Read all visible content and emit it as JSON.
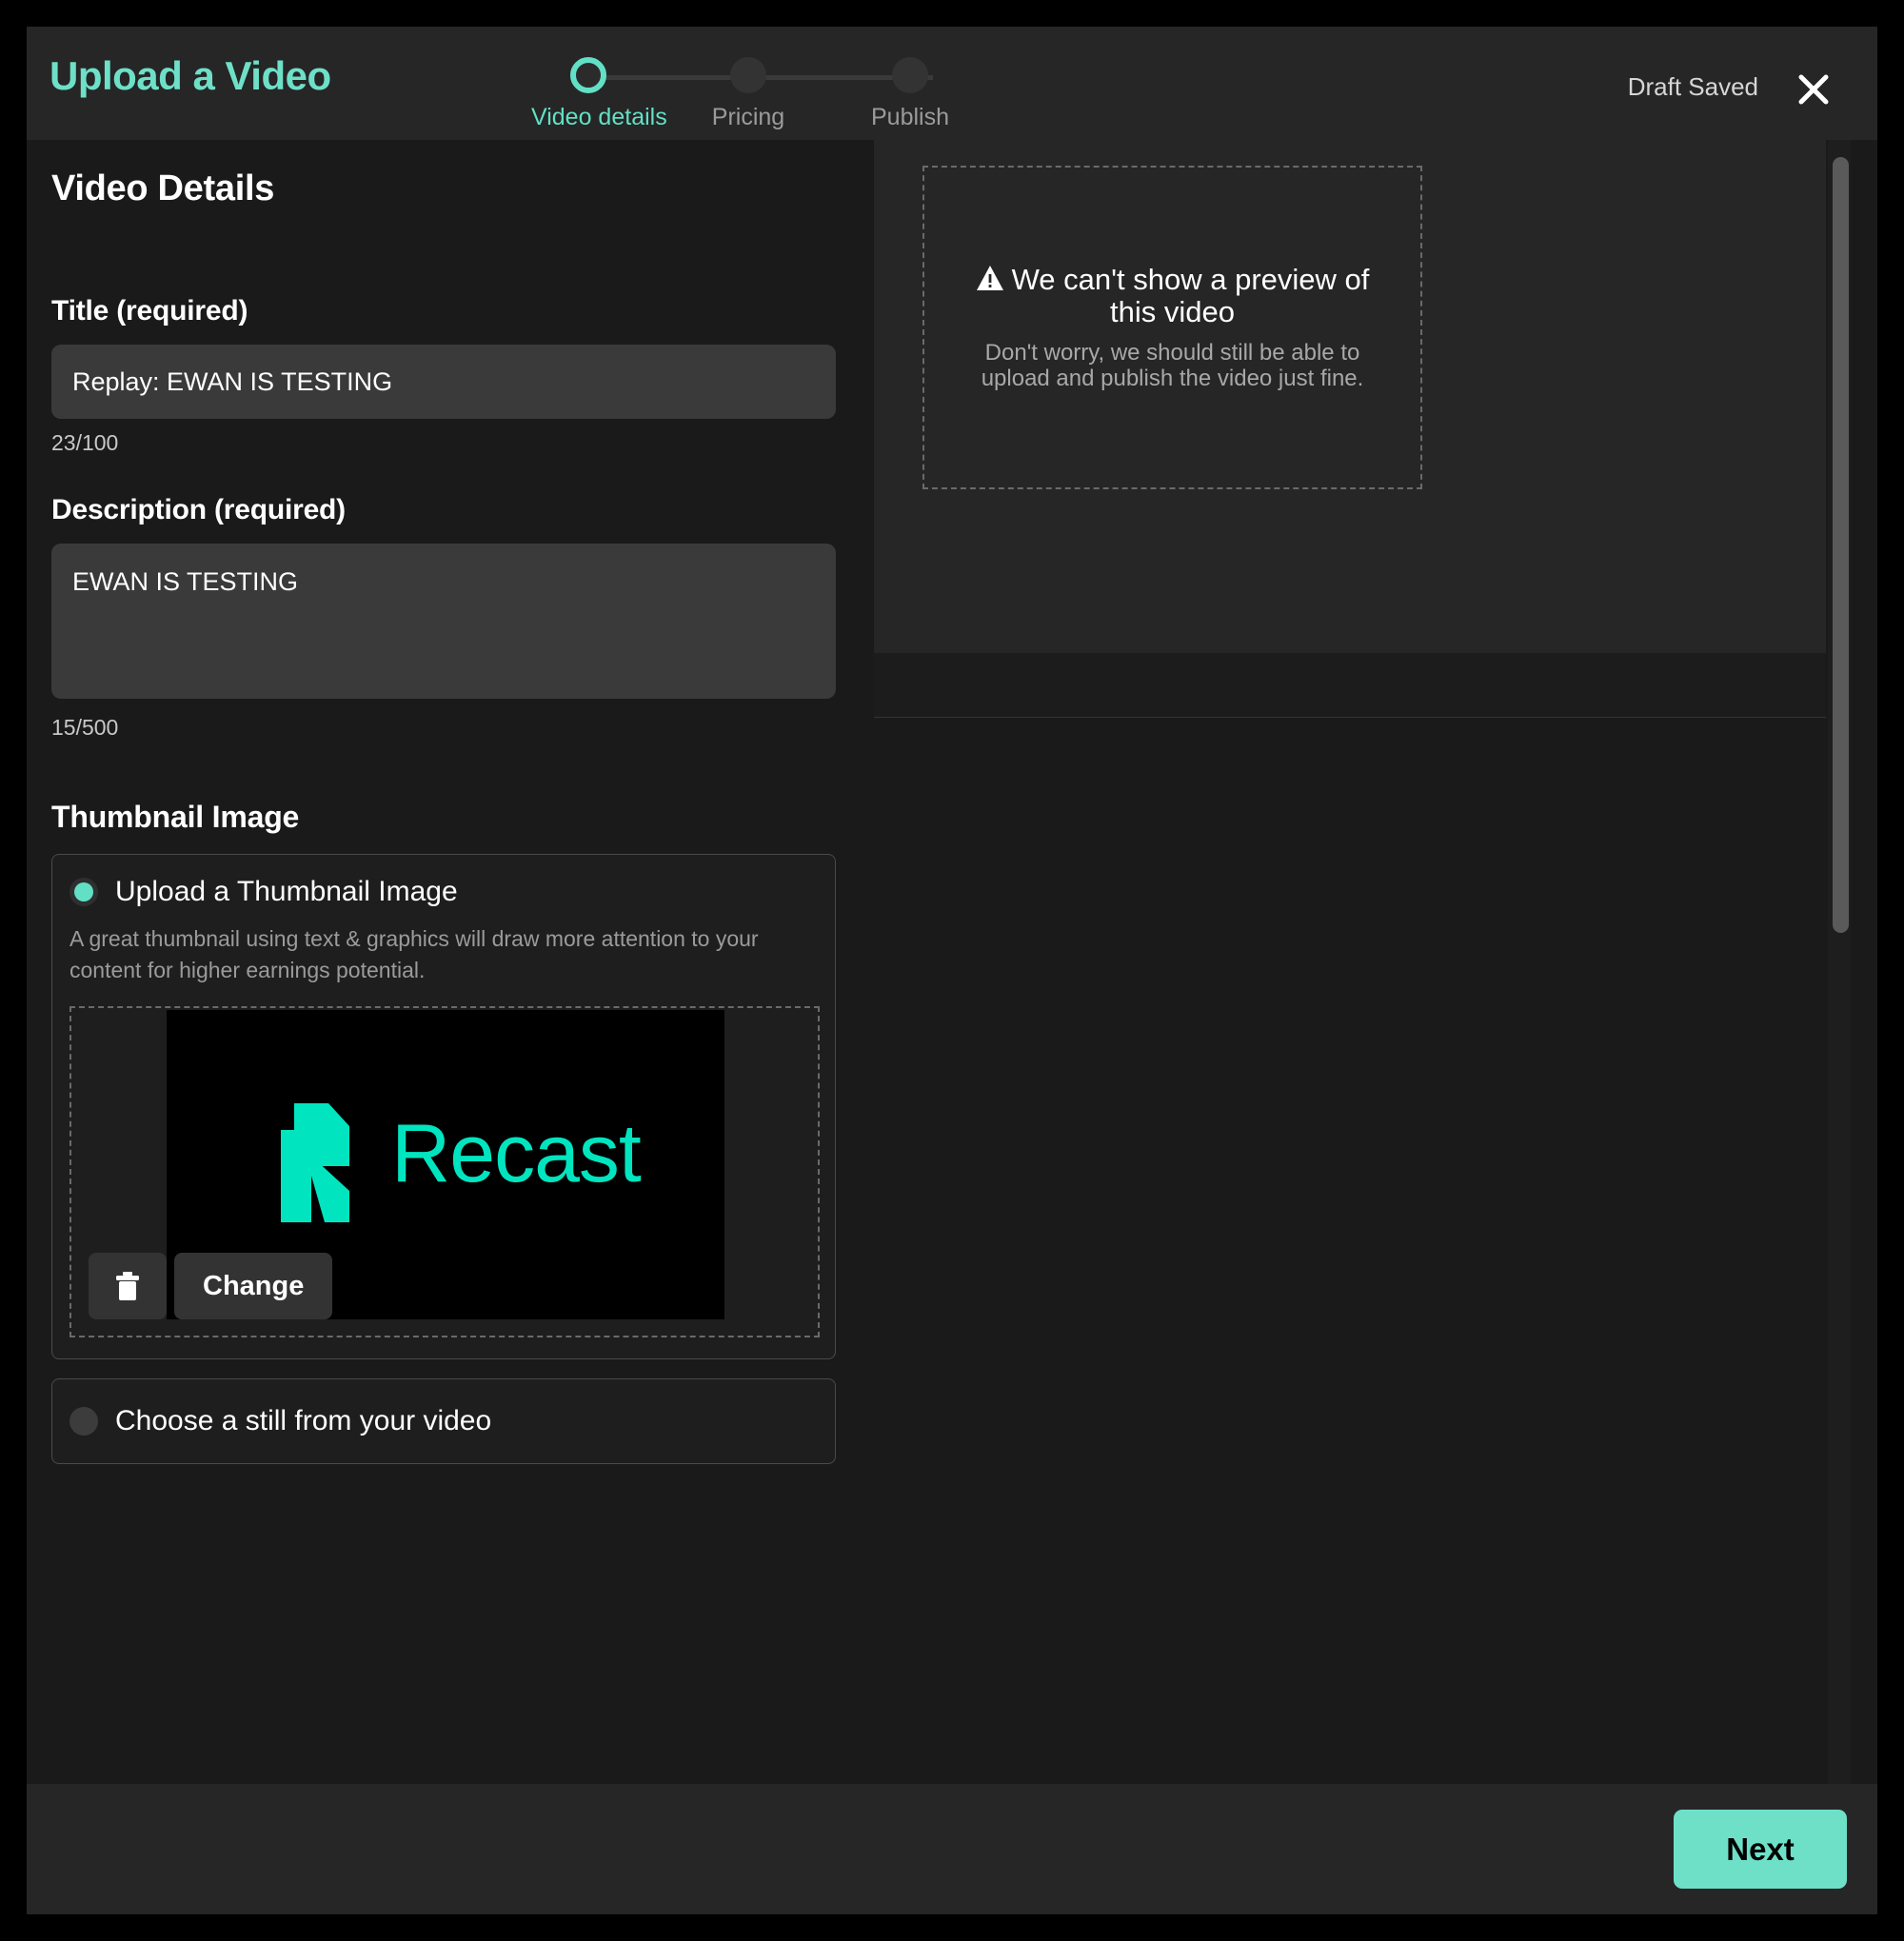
{
  "header": {
    "title": "Upload a Video",
    "draft_status": "Draft Saved",
    "close_icon": "close-icon",
    "steps": [
      {
        "label": "Video details",
        "state": "active"
      },
      {
        "label": "Pricing",
        "state": "inactive"
      },
      {
        "label": "Publish",
        "state": "inactive"
      }
    ]
  },
  "main": {
    "page_title": "Video Details",
    "title_field": {
      "label": "Title (required)",
      "value": "Replay: EWAN IS TESTING",
      "placeholder": "Title",
      "char_count": "23/100"
    },
    "description_field": {
      "label": "Description (required)",
      "value": "EWAN IS TESTING",
      "placeholder": "Description",
      "char_count": "15/500"
    },
    "thumbnail": {
      "heading": "Thumbnail Image",
      "option_upload": {
        "label": "Upload a Thumbnail Image",
        "help": "A great thumbnail using text & graphics will draw more attention to your content for higher earnings potential.",
        "selected": true
      },
      "option_still": {
        "label": "Choose a still from your video",
        "selected": false
      },
      "image_brand_text": "Recast",
      "delete_icon": "trash-icon",
      "change_label": "Change"
    }
  },
  "preview": {
    "warning_icon": "warning-triangle-icon",
    "warning_title": "We can't show a preview of this video",
    "warning_subtitle": "Don't worry, we should still be able to upload and publish the video just fine."
  },
  "footer": {
    "next_label": "Next"
  },
  "colors": {
    "accent": "#6ee0c8",
    "brand_logo": "#00e5c0",
    "header_bg": "#262626",
    "body_bg": "#1a1a1a",
    "input_bg": "#3a3a3a"
  }
}
